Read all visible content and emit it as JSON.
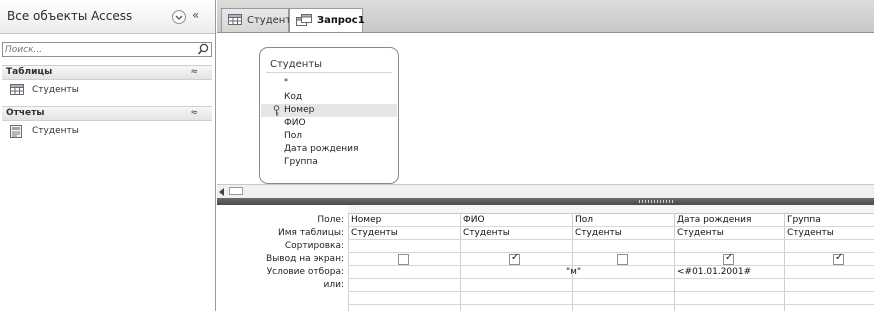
{
  "nav": {
    "title": "Все объекты Access",
    "collapse_glyph": "«",
    "search_placeholder": "Поиск...",
    "groups": [
      {
        "label": "Таблицы",
        "chevron": "≈",
        "items": [
          {
            "label": "Студенты",
            "icon": "table-icon"
          }
        ]
      },
      {
        "label": "Отчеты",
        "chevron": "≈",
        "items": [
          {
            "label": "Студенты",
            "icon": "report-icon"
          }
        ]
      }
    ]
  },
  "tabs": [
    {
      "label": "Студенты",
      "icon": "table-icon",
      "active": false
    },
    {
      "label": "Запрос1",
      "icon": "query-icon",
      "active": true
    }
  ],
  "table_box": {
    "title": "Студенты",
    "fields": [
      "*",
      "Код",
      "Номер",
      "ФИО",
      "Пол",
      "Дата рождения",
      "Группа"
    ],
    "key_field": "Номер"
  },
  "scroll": {
    "left_arrow": "◀"
  },
  "grid": {
    "row_labels": [
      "Поле:",
      "Имя таблицы:",
      "Сортировка:",
      "Вывод на экран:",
      "Условие отбора:",
      "или:"
    ],
    "columns": [
      {
        "field": "Номер",
        "table": "Студенты",
        "sort": "",
        "show": false,
        "criteria": "",
        "or": ""
      },
      {
        "field": "ФИО",
        "table": "Студенты",
        "sort": "",
        "show": true,
        "criteria": "",
        "or": ""
      },
      {
        "field": "Пол",
        "table": "Студенты",
        "sort": "",
        "show": false,
        "criteria": "\"м\"",
        "or": ""
      },
      {
        "field": "Дата рождения",
        "table": "Студенты",
        "sort": "",
        "show": true,
        "criteria": "<#01.01.2001#",
        "or": ""
      },
      {
        "field": "Группа",
        "table": "Студенты",
        "sort": "",
        "show": true,
        "criteria": "",
        "or": ""
      }
    ]
  },
  "colors": {
    "accent": "#f6d28a",
    "splitter": "#555555",
    "border": "#9a9a9a"
  }
}
